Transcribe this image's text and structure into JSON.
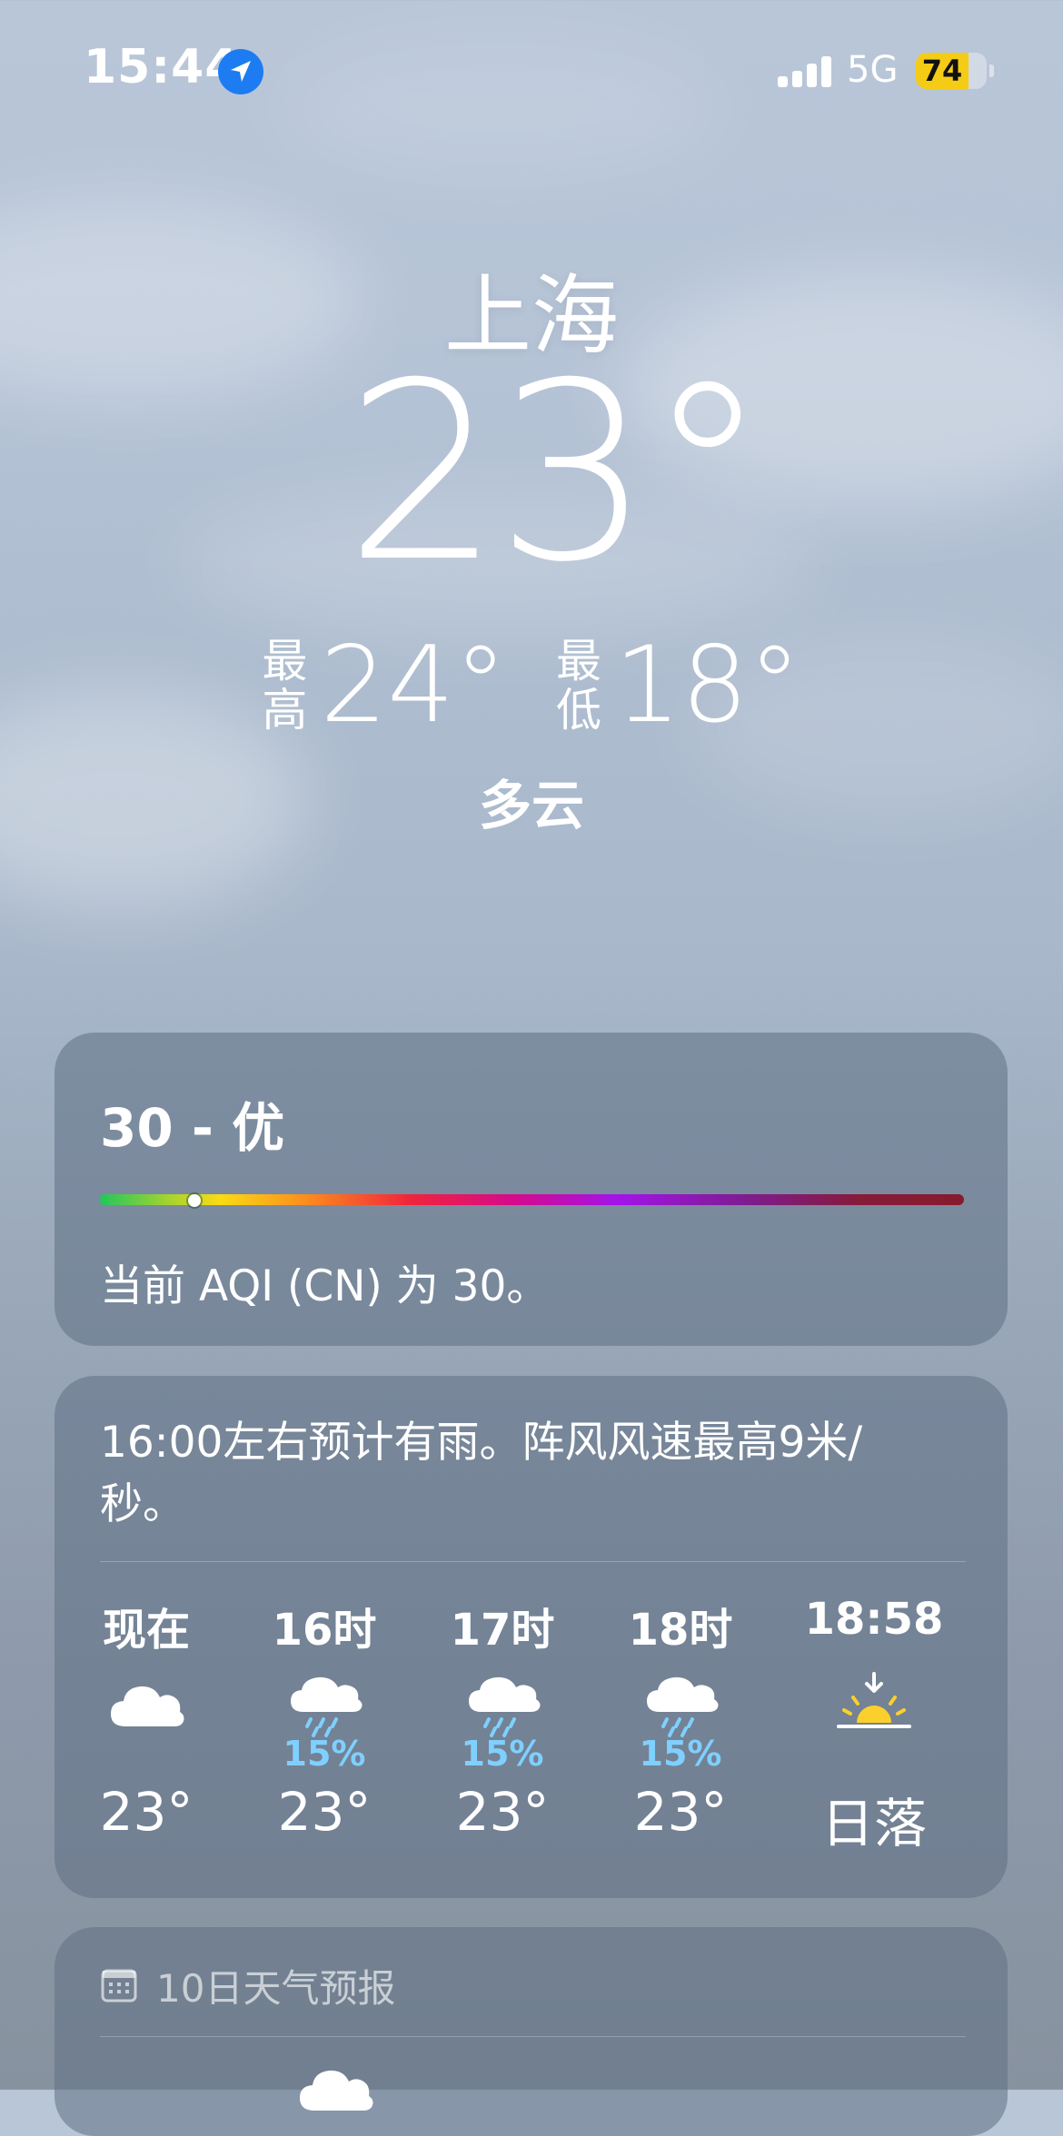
{
  "status_bar": {
    "time": "15:44",
    "network": "5G",
    "battery_percent": "74",
    "battery_level": 0.74,
    "signal_bars_active": 4
  },
  "location": {
    "city": "上海",
    "temperature": "23°",
    "high_label": "最高",
    "high_value": "24°",
    "low_label": "最低",
    "low_value": "18°",
    "condition": "多云"
  },
  "aqi": {
    "value_label": "30 - 优",
    "value": 30,
    "scale_max": 500,
    "description": "当前 AQI (CN) 为 30。"
  },
  "hourly": {
    "summary": "16:00左右预计有雨。阵风风速最高9米/秒。",
    "items": [
      {
        "label": "现在",
        "icon": "cloud-icon",
        "precip": "",
        "temp": "23°"
      },
      {
        "label": "16时",
        "icon": "cloud-rain-icon",
        "precip": "15%",
        "temp": "23°"
      },
      {
        "label": "17时",
        "icon": "cloud-rain-icon",
        "precip": "15%",
        "temp": "23°"
      },
      {
        "label": "18时",
        "icon": "cloud-rain-icon",
        "precip": "15%",
        "temp": "23°"
      },
      {
        "label": "18:58",
        "icon": "sunset-icon",
        "precip": "",
        "temp": "日落"
      }
    ]
  },
  "forecast": {
    "title": "10日天气预报",
    "icon": "calendar-icon"
  },
  "colors": {
    "card_background": "#5e7084",
    "precip_text": "#7fd0ff",
    "sun_yellow": "#fbd02c",
    "battery_yellow": "#f5cc15",
    "location_blue": "#1e7cf2"
  }
}
